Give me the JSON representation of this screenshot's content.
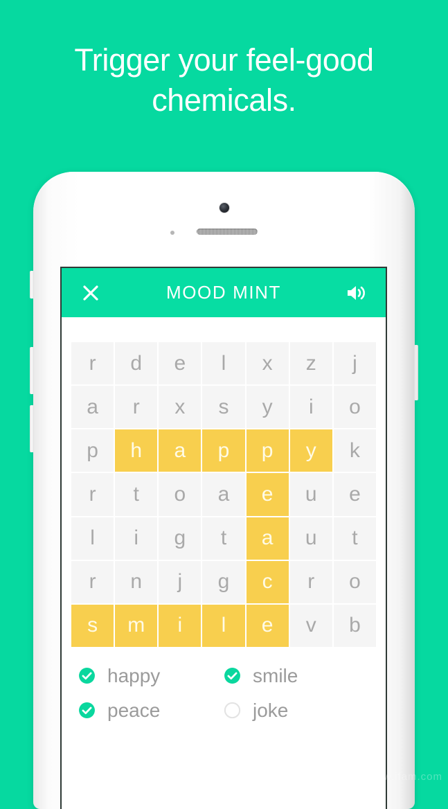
{
  "promo": {
    "headline": "Trigger your feel-good chemicals.",
    "background_color": "#06d9a0",
    "text_color": "#ffffff"
  },
  "app": {
    "header": {
      "title": "MOOD MINT",
      "close_icon": "close-x-icon",
      "sound_icon": "speaker-on-icon",
      "background_color": "#07dda3"
    },
    "grid": {
      "rows": 7,
      "cols": 7,
      "cell_color": "#f5f5f5",
      "letter_color": "#a9a9a9",
      "highlight_color": "#f8cf4e",
      "highlight_letter_color": "#fffbe6",
      "letters": [
        [
          "r",
          "d",
          "e",
          "l",
          "x",
          "z",
          "j"
        ],
        [
          "a",
          "r",
          "x",
          "s",
          "y",
          "i",
          "o"
        ],
        [
          "p",
          "h",
          "a",
          "p",
          "p",
          "y",
          "k"
        ],
        [
          "r",
          "t",
          "o",
          "a",
          "e",
          "u",
          "e"
        ],
        [
          "l",
          "i",
          "g",
          "t",
          "a",
          "u",
          "t"
        ],
        [
          "r",
          "n",
          "j",
          "g",
          "c",
          "r",
          "o"
        ],
        [
          "s",
          "m",
          "i",
          "l",
          "e",
          "v",
          "b"
        ]
      ],
      "highlighted": [
        [
          false,
          false,
          false,
          false,
          false,
          false,
          false
        ],
        [
          false,
          false,
          false,
          false,
          false,
          false,
          false
        ],
        [
          false,
          true,
          true,
          true,
          true,
          true,
          false
        ],
        [
          false,
          false,
          false,
          false,
          true,
          false,
          false
        ],
        [
          false,
          false,
          false,
          false,
          true,
          false,
          false
        ],
        [
          false,
          false,
          false,
          false,
          true,
          false,
          false
        ],
        [
          true,
          true,
          true,
          true,
          true,
          false,
          false
        ]
      ]
    },
    "word_list": [
      {
        "label": "happy",
        "found": true,
        "icon": "check-circle-icon"
      },
      {
        "label": "smile",
        "found": true,
        "icon": "check-circle-icon"
      },
      {
        "label": "peace",
        "found": true,
        "icon": "check-circle-icon"
      },
      {
        "label": "joke",
        "found": false,
        "icon": "empty-circle-icon"
      }
    ],
    "word_found_color": "#0ad79e",
    "word_pending_color": "#e3e3e3",
    "word_text_color": "#9b9b9b"
  },
  "watermark": {
    "text": "www.ifam.com"
  }
}
